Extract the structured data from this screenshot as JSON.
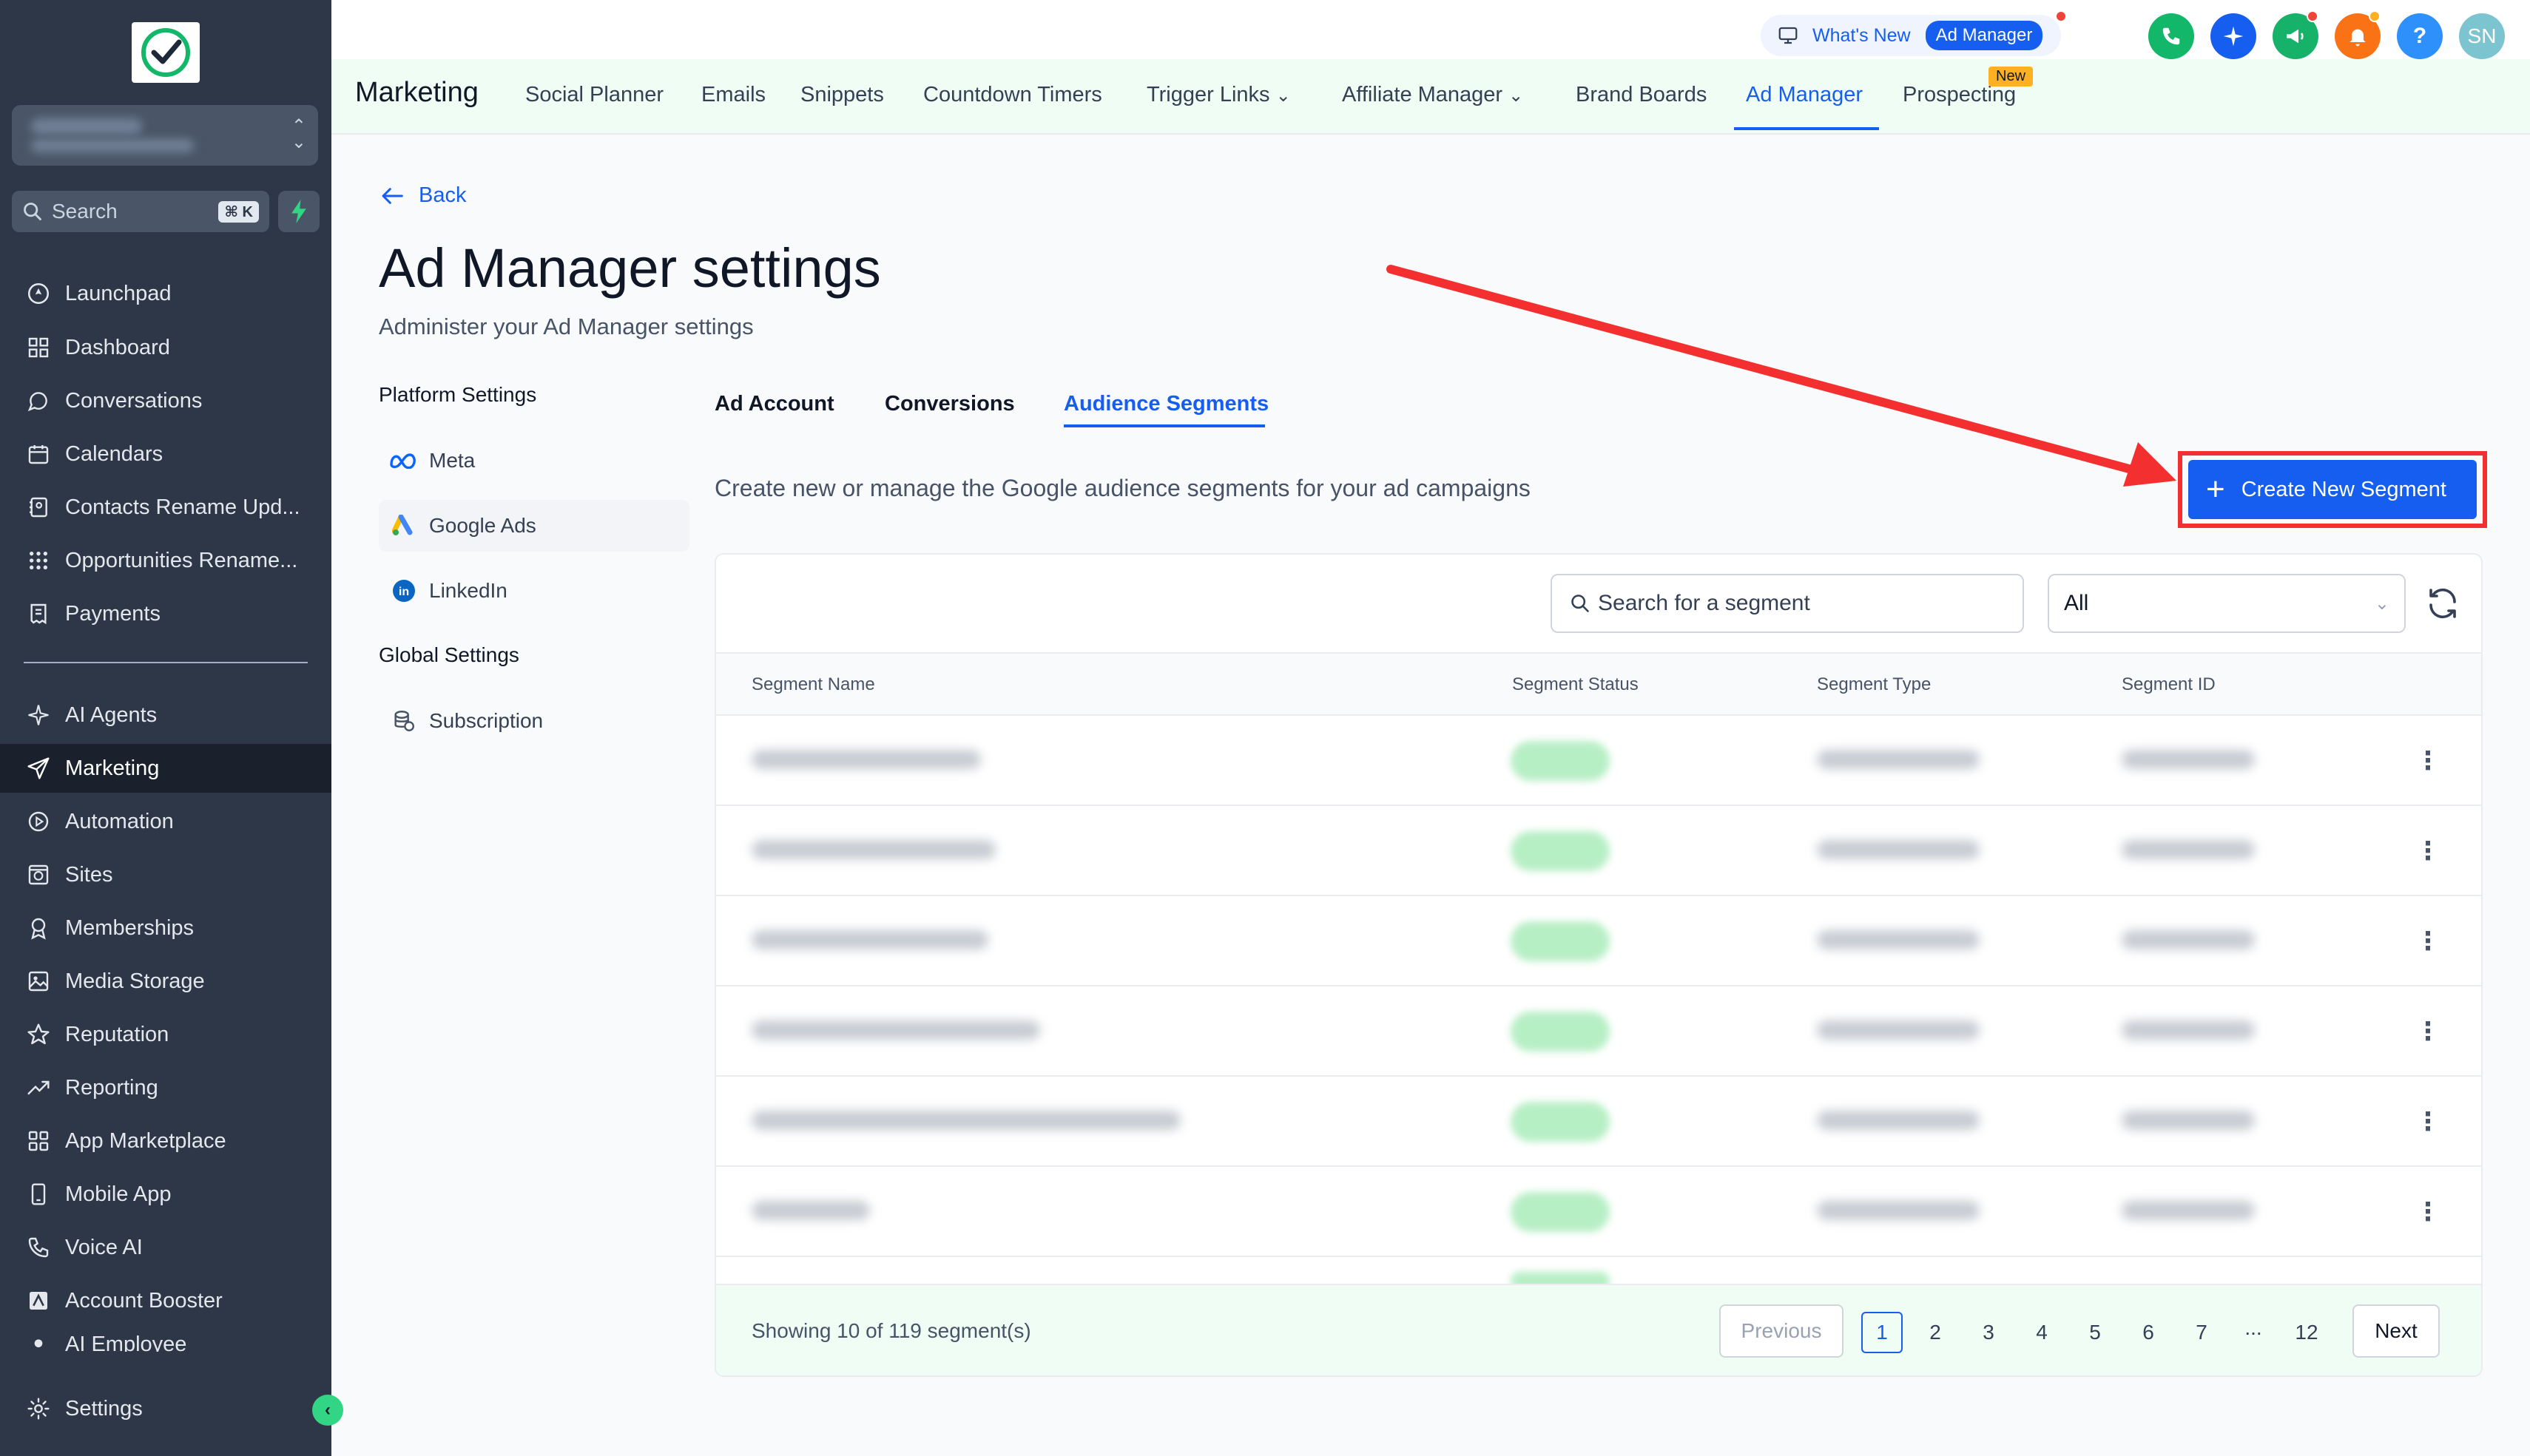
{
  "sidebar": {
    "search_placeholder": "Search",
    "search_shortcut": "⌘ K",
    "items": [
      {
        "label": "Launchpad",
        "icon": "rocket-icon"
      },
      {
        "label": "Dashboard",
        "icon": "grid-icon"
      },
      {
        "label": "Conversations",
        "icon": "chat-icon"
      },
      {
        "label": "Calendars",
        "icon": "calendar-icon"
      },
      {
        "label": "Contacts Rename Upd...",
        "icon": "contacts-icon"
      },
      {
        "label": "Opportunities Rename...",
        "icon": "pipeline-icon"
      },
      {
        "label": "Payments",
        "icon": "receipt-icon"
      },
      {
        "label": "AI Agents",
        "icon": "sparkle-icon"
      },
      {
        "label": "Marketing",
        "icon": "send-icon"
      },
      {
        "label": "Automation",
        "icon": "automation-icon"
      },
      {
        "label": "Sites",
        "icon": "globe-icon"
      },
      {
        "label": "Memberships",
        "icon": "membership-icon"
      },
      {
        "label": "Media Storage",
        "icon": "image-icon"
      },
      {
        "label": "Reputation",
        "icon": "star-icon"
      },
      {
        "label": "Reporting",
        "icon": "trend-icon"
      },
      {
        "label": "App Marketplace",
        "icon": "apps-icon"
      },
      {
        "label": "Mobile App",
        "icon": "phone-icon"
      },
      {
        "label": "Voice AI",
        "icon": "voice-icon"
      },
      {
        "label": "Account Booster",
        "icon": "booster-icon"
      },
      {
        "label": "AI Employee",
        "icon": "employee-icon"
      }
    ],
    "settings_label": "Settings"
  },
  "topbar": {
    "whats_new": "What's New",
    "whats_new_pill": "Ad Manager",
    "avatar_initials": "SN",
    "help": "?"
  },
  "subnav": {
    "brand": "Marketing",
    "tabs": [
      "Social Planner",
      "Emails",
      "Snippets",
      "Countdown Timers",
      "Trigger Links",
      "Affiliate Manager",
      "Brand Boards",
      "Ad Manager",
      "Prospecting"
    ],
    "new_badge": "New"
  },
  "page": {
    "back": "Back",
    "title": "Ad Manager settings",
    "subtitle": "Administer your Ad Manager settings",
    "platform_heading": "Platform Settings",
    "platforms": [
      "Meta",
      "Google Ads",
      "LinkedIn"
    ],
    "global_heading": "Global Settings",
    "global_items": [
      "Subscription"
    ],
    "content_tabs": [
      "Ad Account",
      "Conversions",
      "Audience Segments"
    ],
    "description": "Create new or manage the Google audience segments for your ad campaigns",
    "create_button": "Create New Segment"
  },
  "table": {
    "search_placeholder": "Search for a segment",
    "filter_value": "All",
    "columns": [
      "Segment Name",
      "Segment Status",
      "Segment Type",
      "Segment ID"
    ],
    "showing": "Showing 10 of 119 segment(s)",
    "previous": "Previous",
    "next": "Next",
    "pages": [
      "1",
      "2",
      "3",
      "4",
      "5",
      "6",
      "7",
      "...",
      "12"
    ]
  },
  "colors": {
    "sidebar_bg": "#2d3748",
    "accent": "#155eef",
    "annotation_red": "#f42f2f",
    "subnav_bg": "#f0fdf4"
  }
}
